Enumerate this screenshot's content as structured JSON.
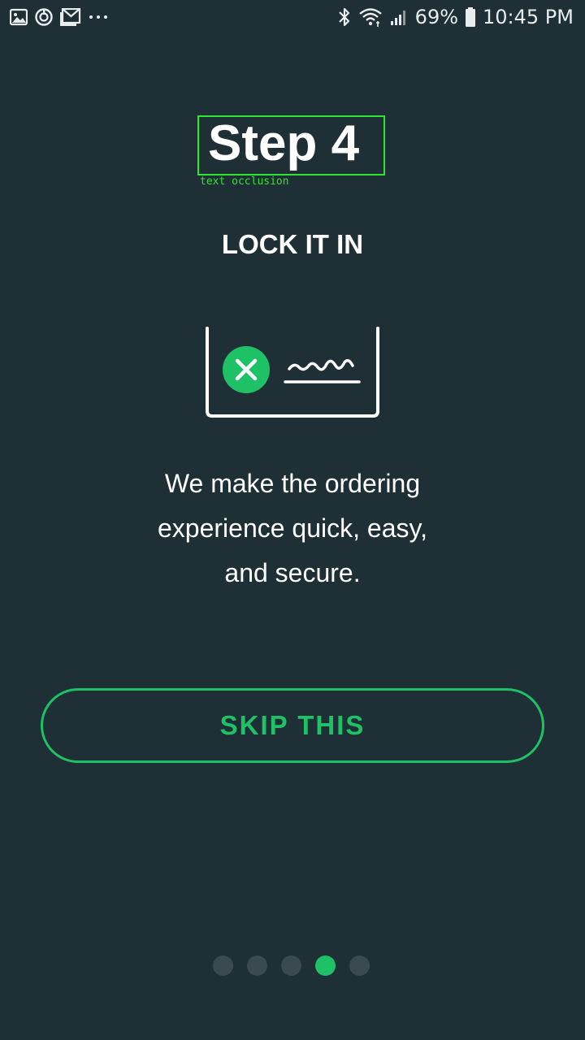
{
  "status_bar": {
    "left_icons": [
      "image-icon",
      "sync-icon",
      "gmail-icon",
      "more-icon"
    ],
    "right_icons": [
      "bluetooth-icon",
      "wifi-icon",
      "signal-icon",
      "battery-icon"
    ],
    "battery_percent": "69%",
    "time": "10:45 PM"
  },
  "onboarding": {
    "step_title": "Step 4",
    "occlusion_label": "text occlusion",
    "subtitle": "LOCK IT IN",
    "illustration_icons": [
      "close-circle-icon",
      "signature-icon"
    ],
    "description_lines": [
      "We make the ordering",
      "experience quick, easy,",
      "and secure."
    ],
    "skip_label": "SKIP THIS",
    "pager": {
      "total": 5,
      "active_index": 3
    }
  },
  "colors": {
    "background": "#1e2f35",
    "accent": "#1fc167",
    "inactive_dot": "#3b4a50",
    "occlusion_box": "#2ee62e"
  }
}
